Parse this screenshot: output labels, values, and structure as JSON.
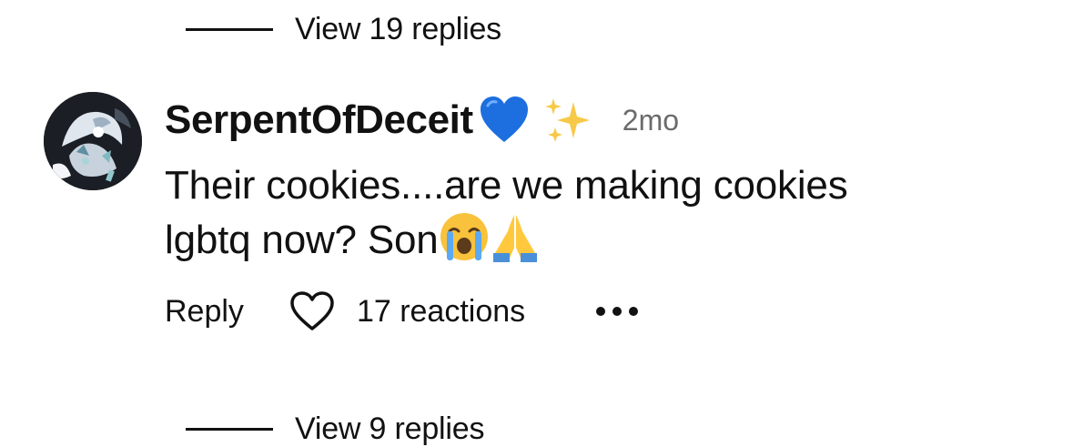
{
  "thread_top": {
    "view_replies_label": "View 19 replies"
  },
  "comment": {
    "username": "SerpentOfDeceit",
    "username_emojis": [
      "blue-heart",
      "sparkles"
    ],
    "timestamp": "2mo",
    "text_line1": "Their cookies....are we making cookies",
    "text_line2": "lgbtq now? Son",
    "text_emojis": [
      "loudly-crying-face",
      "folded-hands"
    ],
    "actions": {
      "reply_label": "Reply",
      "reaction_icon": "heart-outline-icon",
      "reactions_label": "17 reactions",
      "more_icon": "more-horizontal-icon"
    }
  },
  "thread_bottom": {
    "view_replies_label": "View 9 replies"
  },
  "colors": {
    "text": "#111111",
    "timestamp": "#6b6b6b",
    "background": "#ffffff"
  }
}
